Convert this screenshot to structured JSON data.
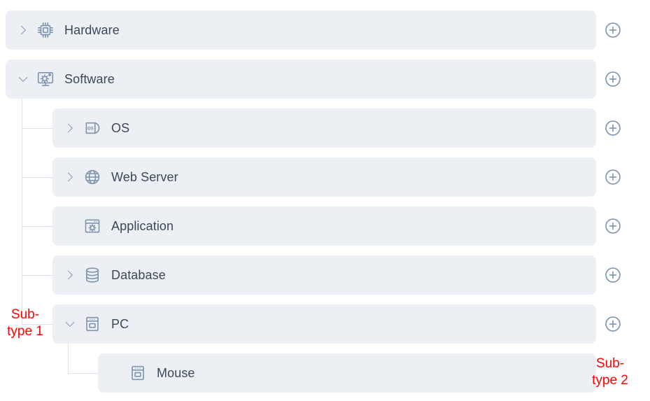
{
  "colors": {
    "row_background": "#ecf0f5",
    "label_text": "#3c4858",
    "icon": "#7f94ae",
    "chevron": "#9aa9bd",
    "connector_line": "#dbe2ea",
    "annotation_red": "#ff0000",
    "page_background": "#ffffff"
  },
  "tree": {
    "nodes": [
      {
        "id": "hardware",
        "label": "Hardware",
        "level": 0,
        "icon": "cpu-chip-icon",
        "chevron": "chevron-right-icon",
        "expanded": false,
        "has_chevron": true,
        "has_add_button": true,
        "add_button_icon": "plus-circle-icon"
      },
      {
        "id": "software",
        "label": "Software",
        "level": 0,
        "icon": "monitor-gear-icon",
        "chevron": "chevron-down-icon",
        "expanded": true,
        "has_chevron": true,
        "has_add_button": true,
        "add_button_icon": "plus-circle-icon"
      },
      {
        "id": "os",
        "label": "OS",
        "level": 1,
        "icon": "os-disc-icon",
        "chevron": "chevron-right-icon",
        "expanded": false,
        "has_chevron": true,
        "has_add_button": true,
        "add_button_icon": "plus-circle-icon"
      },
      {
        "id": "web-server",
        "label": "Web Server",
        "level": 1,
        "icon": "globe-icon",
        "chevron": "chevron-right-icon",
        "expanded": false,
        "has_chevron": true,
        "has_add_button": true,
        "add_button_icon": "plus-circle-icon"
      },
      {
        "id": "application",
        "label": "Application",
        "level": 1,
        "icon": "window-gear-icon",
        "chevron": "",
        "expanded": false,
        "has_chevron": false,
        "has_add_button": true,
        "add_button_icon": "plus-circle-icon"
      },
      {
        "id": "database",
        "label": "Database",
        "level": 1,
        "icon": "database-cylinder-icon",
        "chevron": "chevron-right-icon",
        "expanded": false,
        "has_chevron": true,
        "has_add_button": true,
        "add_button_icon": "plus-circle-icon"
      },
      {
        "id": "pc",
        "label": "PC",
        "level": 1,
        "icon": "server-box-icon",
        "chevron": "chevron-down-icon",
        "expanded": true,
        "has_chevron": true,
        "has_add_button": true,
        "add_button_icon": "plus-circle-icon"
      },
      {
        "id": "mouse",
        "label": "Mouse",
        "level": 2,
        "icon": "server-box-icon",
        "chevron": "",
        "expanded": false,
        "has_chevron": false,
        "has_add_button": false,
        "add_button_icon": ""
      }
    ]
  },
  "annotations": [
    {
      "id": "sub-type-1",
      "text": "Sub-\ntype 1"
    },
    {
      "id": "sub-type-2",
      "text": "Sub-\ntype 2"
    }
  ]
}
